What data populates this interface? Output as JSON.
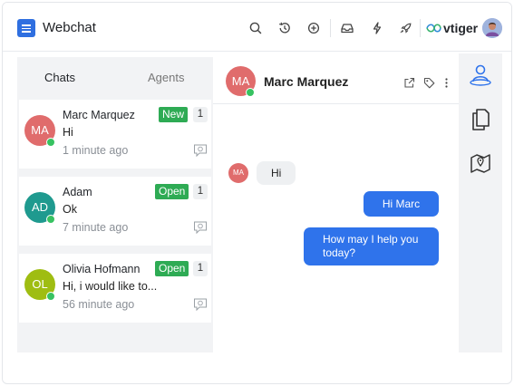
{
  "app": {
    "title": "Webchat",
    "brand": "vtiger"
  },
  "toolbar": {
    "icons": [
      "search-icon",
      "history-icon",
      "add-circle-icon",
      "inbox-icon",
      "lightning-icon",
      "rocket-icon"
    ]
  },
  "tabs": {
    "chats": "Chats",
    "agents": "Agents"
  },
  "chats": [
    {
      "initials": "MA",
      "name": "Marc Marquez",
      "message": "Hi",
      "time": "1 minute ago",
      "badge": "New",
      "count": "1",
      "avatar_color": "#e06c6c"
    },
    {
      "initials": "AD",
      "name": "Adam",
      "message": "Ok",
      "time": "7 minute ago",
      "badge": "Open",
      "count": "1",
      "avatar_color": "#1f9a8f"
    },
    {
      "initials": "OL",
      "name": "Olivia Hofmann",
      "message": "Hi, i would like to...",
      "time": "56 minute ago",
      "badge": "Open",
      "count": "1",
      "avatar_color": "#9fbd12"
    }
  ],
  "conversation": {
    "contact_initials": "MA",
    "contact_name": "Marc Marquez",
    "messages": [
      {
        "from": "contact",
        "initials": "MA",
        "text": "Hi"
      },
      {
        "from": "agent",
        "text": "Hi Marc"
      },
      {
        "from": "agent",
        "text_line1": "How may I help you",
        "text_line2": "today?"
      }
    ]
  },
  "colors": {
    "accent": "#2f73eb",
    "status_green": "#2eab54",
    "online": "#37c261"
  }
}
